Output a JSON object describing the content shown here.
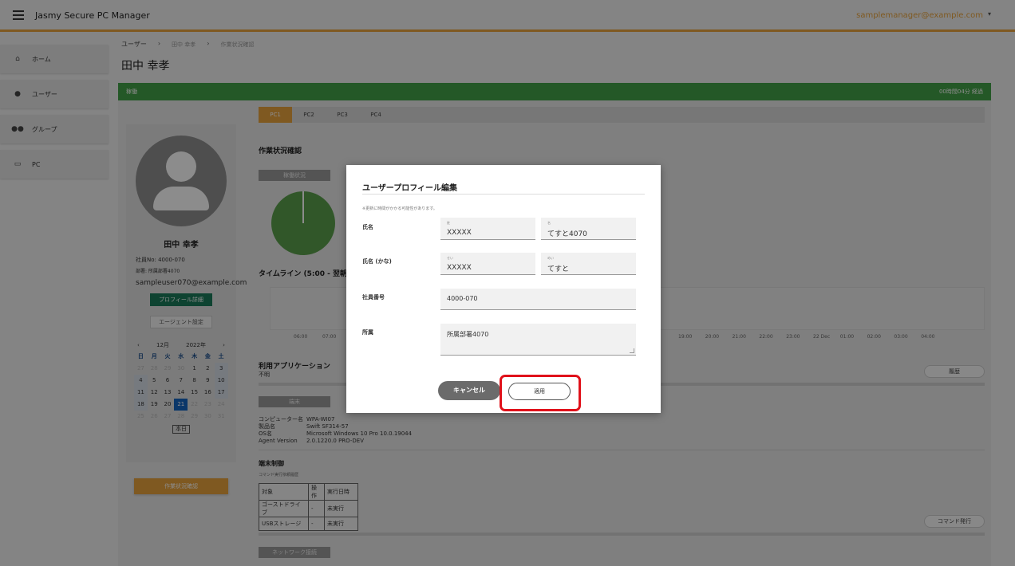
{
  "app": {
    "title": "Jasmy Secure PC Manager",
    "user_email": "samplemanager@example.com",
    "caret": "▾"
  },
  "sidebar": {
    "items": [
      {
        "icon": "home-icon",
        "glyph": "⌂",
        "label": "ホーム"
      },
      {
        "icon": "user-icon",
        "glyph": "●",
        "label": "ユーザー"
      },
      {
        "icon": "group-icon",
        "glyph": "●●",
        "label": "グループ"
      },
      {
        "icon": "pc-icon",
        "glyph": "▭",
        "label": "PC"
      }
    ]
  },
  "breadcrumb": {
    "items": [
      "ユーザー",
      "田中 幸孝",
      "作業状況確認"
    ],
    "sep": "›"
  },
  "page_title": "田中 幸孝",
  "status_bar": {
    "left": "稼働",
    "right": "00時間04分 経過"
  },
  "profile": {
    "name": "田中 幸孝",
    "employee_no": "社員No: 4000-070",
    "department": "部署: 所属部署4070",
    "email": "sampleuser070@example.com",
    "profile_button": "プロフィール詳細",
    "agent_button": "エージェント設定",
    "work_button": "作業状況確認"
  },
  "calendar": {
    "month": "12月",
    "year": "2022年",
    "prev": "‹",
    "next": "›",
    "dow": [
      "日",
      "月",
      "火",
      "水",
      "木",
      "金",
      "土"
    ],
    "weeks": [
      [
        "27",
        "28",
        "29",
        "30",
        "1",
        "2",
        "3"
      ],
      [
        "4",
        "5",
        "6",
        "7",
        "8",
        "9",
        "10"
      ],
      [
        "11",
        "12",
        "13",
        "14",
        "15",
        "16",
        "17"
      ],
      [
        "18",
        "19",
        "20",
        "21",
        "22",
        "23",
        "24"
      ],
      [
        "25",
        "26",
        "27",
        "28",
        "29",
        "30",
        "31"
      ]
    ],
    "today": "21",
    "today_button": "本日"
  },
  "pc_tabs": [
    "PC1",
    "PC2",
    "PC3",
    "PC4"
  ],
  "work_status": {
    "title": "作業状況確認",
    "operation_chip": "稼働状況",
    "timeline_title": "タイムライン (5:00 - 翌朝5:00)",
    "ticks_left": [
      "06:00",
      "07:00"
    ],
    "ticks_right": [
      "19:00",
      "20:00",
      "21:00",
      "22:00",
      "23:00",
      "22 Dec",
      "01:00",
      "02:00",
      "03:00",
      "04:00"
    ],
    "apps_title": "利用アプリケーション",
    "apps_value": "不明",
    "history_button": "履歴",
    "terminal_chip": "端末",
    "specs": [
      {
        "k": "コンピューター名",
        "v": "WPA-WI07"
      },
      {
        "k": "製品名",
        "v": "Swift SF314-57"
      },
      {
        "k": "OS名",
        "v": "Microsoft Windows 10 Pro 10.0.19044"
      },
      {
        "k": "Agent Version",
        "v": "2.0.1220.0 PRO-DEV"
      }
    ],
    "control_title": "端末制御",
    "control_sub": "コマンド実行依頼履歴",
    "cmd_header": [
      "対象",
      "操作",
      "実行日時"
    ],
    "cmd_rows": [
      [
        "ゴーストドライブ",
        "-",
        "未実行"
      ],
      [
        "USBストレージ",
        "-",
        "未実行"
      ]
    ],
    "command_button": "コマンド発行",
    "network_chip": "ネットワーク接続"
  },
  "modal": {
    "title": "ユーザープロフィール編集",
    "note": "※更新に時間がかかる可能性があります。",
    "name_label": "氏名",
    "last_hint": "姓",
    "last_value": "XXXXX",
    "first_hint": "名",
    "first_value": "てすと4070",
    "kana_label": "氏名 (かな)",
    "last_kana_hint": "せい",
    "last_kana_value": "XXXXX",
    "first_kana_hint": "めい",
    "first_kana_value": "てすと",
    "employee_label": "社員番号",
    "employee_value": "4000-070",
    "dept_label": "所属",
    "dept_value": "所属部署4070",
    "cancel": "キャンセル",
    "apply": "適用"
  },
  "colors": {
    "accent": "#e8a33d",
    "green": "#43a047",
    "teal": "#1b7a5a",
    "highlight": "#e0111a",
    "today": "#1565c0"
  }
}
